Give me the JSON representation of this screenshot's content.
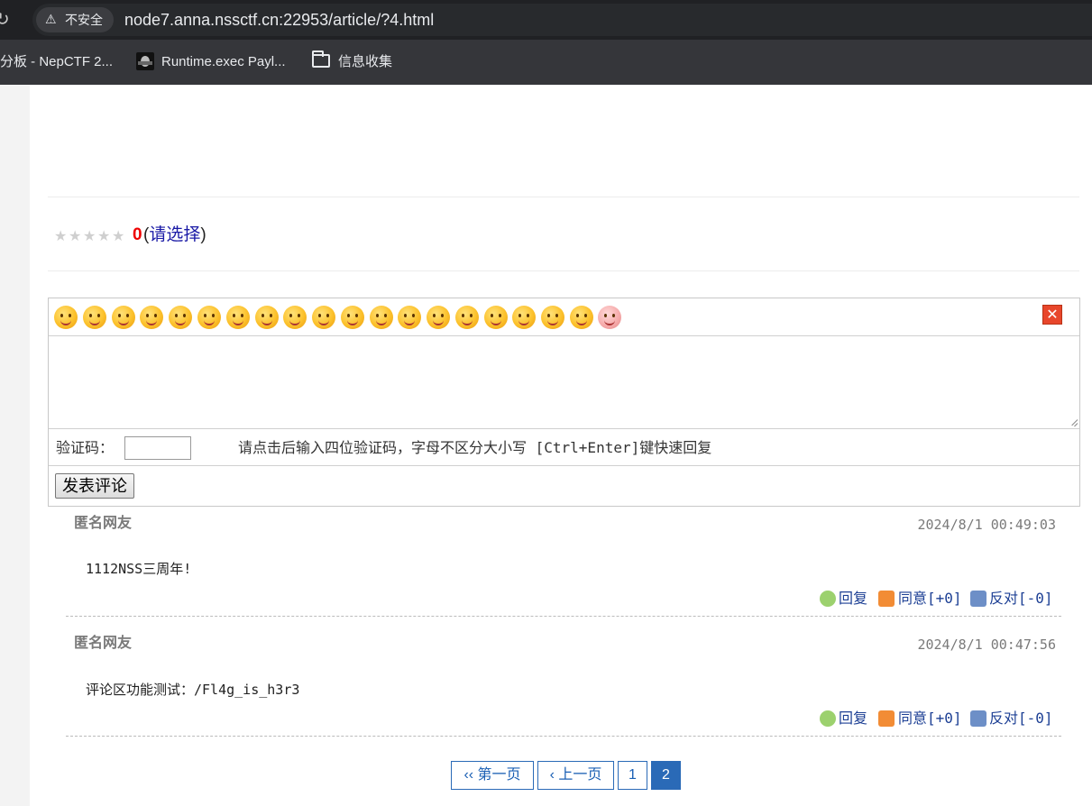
{
  "browser": {
    "security_label": "不安全",
    "url": "node7.anna.nssctf.cn:22953/article/?4.html",
    "bookmarks": [
      {
        "label": "分板 - NepCTF 2..."
      },
      {
        "label": "Runtime.exec Payl..."
      },
      {
        "label": "信息收集"
      }
    ]
  },
  "rating": {
    "value": "0",
    "link_prefix": "(",
    "link_label": "请选择",
    "link_suffix": ")",
    "stars_total": 5
  },
  "comment_form": {
    "close_label": "✕",
    "captcha_label": "验证码：",
    "captcha_hint": "请点击后输入四位验证码，字母不区分大小写 [Ctrl+Enter]键快速回复",
    "submit_label": "发表评论",
    "emoji_count": 20
  },
  "comments": [
    {
      "author": "匿名网友",
      "time": "2024/8/1 00:49:03",
      "body": "1112NSS三周年!",
      "reply_label": "回复",
      "agree_label": "同意[+0]",
      "oppose_label": "反对[-0]"
    },
    {
      "author": "匿名网友",
      "time": "2024/8/1 00:47:56",
      "body": "评论区功能测试：/Fl4g_is_h3r3",
      "reply_label": "回复",
      "agree_label": "同意[+0]",
      "oppose_label": "反对[-0]"
    }
  ],
  "pagination": {
    "first_label": "‹‹ 第一页",
    "prev_label": "‹ 上一页",
    "pages": [
      "1",
      "2"
    ],
    "current": "2"
  }
}
